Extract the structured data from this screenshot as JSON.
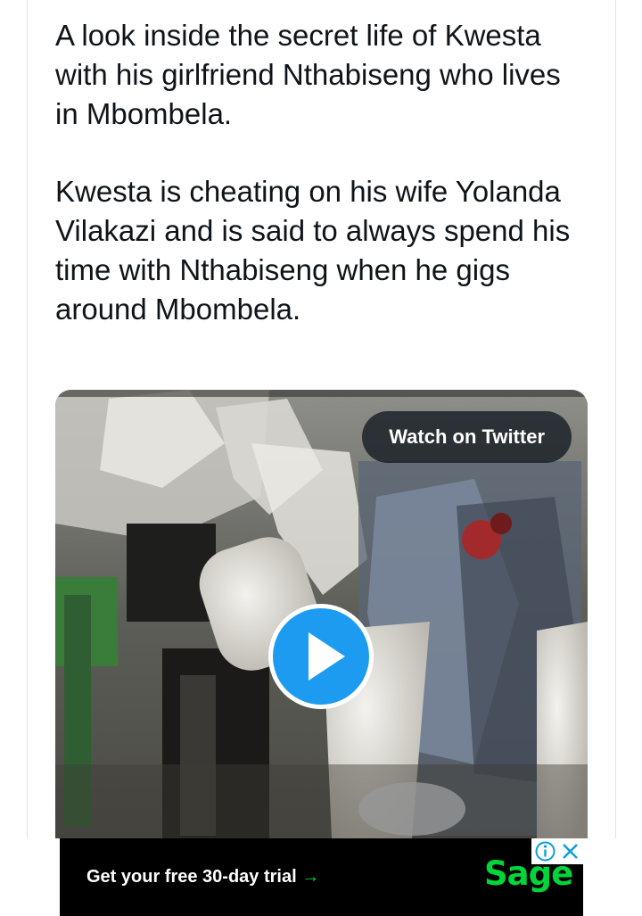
{
  "tweet": {
    "paragraph_1": "A look inside the secret life of Kwesta with his girlfriend Nthabiseng who lives in Mbombela.",
    "paragraph_2": "Kwesta is cheating on his wife Yolanda Vilakazi and is said to always spend his time with Nthabiseng when he gigs around Mbombela."
  },
  "media": {
    "watch_label": "Watch on Twitter",
    "play_icon": "play-icon",
    "play_color": "#1d9bf0"
  },
  "ad": {
    "cta": "Get your free 30-day trial",
    "arrow": "→",
    "brand": "Sage",
    "brand_color": "#00d639",
    "info_icon": "info-icon",
    "close_icon": "close-icon"
  }
}
